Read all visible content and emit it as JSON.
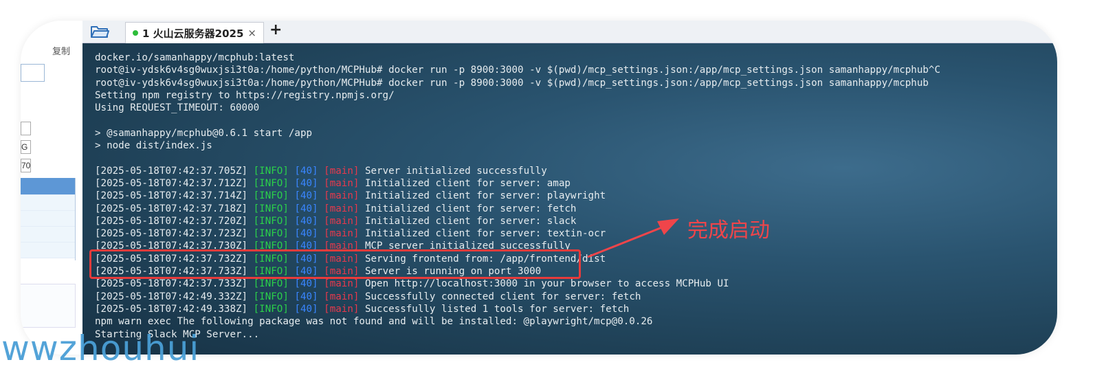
{
  "left_panel": {
    "copy_label": "复制",
    "box_c_text": "G",
    "box_d_text": "70"
  },
  "tab": {
    "title": "1 火山云服务器2025",
    "close_label": "×",
    "add_label": "+"
  },
  "terminal": {
    "header_lines": [
      "docker.io/samanhappy/mcphub:latest",
      "root@iv-ydsk6v4sg0wuxjsi3t0a:/home/python/MCPHub# docker run -p 8900:3000 -v $(pwd)/mcp_settings.json:/app/mcp_settings.json samanhappy/mcphub^C",
      "root@iv-ydsk6v4sg0wuxjsi3t0a:/home/python/MCPHub# docker run -p 8900:3000 -v $(pwd)/mcp_settings.json:/app/mcp_settings.json samanhappy/mcphub",
      "Setting npm registry to https://registry.npmjs.org/",
      "Using REQUEST_TIMEOUT: 60000",
      "",
      "> @samanhappy/mcphub@0.6.1 start /app",
      "> node dist/index.js",
      ""
    ],
    "log_lines": [
      {
        "ts": "[2025-05-18T07:42:37.705Z]",
        "level": "[INFO]",
        "pid": "[40]",
        "mod": "[main]",
        "msg": "Server initialized successfully"
      },
      {
        "ts": "[2025-05-18T07:42:37.712Z]",
        "level": "[INFO]",
        "pid": "[40]",
        "mod": "[main]",
        "msg": "Initialized client for server: amap"
      },
      {
        "ts": "[2025-05-18T07:42:37.714Z]",
        "level": "[INFO]",
        "pid": "[40]",
        "mod": "[main]",
        "msg": "Initialized client for server: playwright"
      },
      {
        "ts": "[2025-05-18T07:42:37.718Z]",
        "level": "[INFO]",
        "pid": "[40]",
        "mod": "[main]",
        "msg": "Initialized client for server: fetch"
      },
      {
        "ts": "[2025-05-18T07:42:37.720Z]",
        "level": "[INFO]",
        "pid": "[40]",
        "mod": "[main]",
        "msg": "Initialized client for server: slack"
      },
      {
        "ts": "[2025-05-18T07:42:37.723Z]",
        "level": "[INFO]",
        "pid": "[40]",
        "mod": "[main]",
        "msg": "Initialized client for server: textin-ocr"
      },
      {
        "ts": "[2025-05-18T07:42:37.730Z]",
        "level": "[INFO]",
        "pid": "[40]",
        "mod": "[main]",
        "msg": "MCP server initialized successfully"
      },
      {
        "ts": "[2025-05-18T07:42:37.732Z]",
        "level": "[INFO]",
        "pid": "[40]",
        "mod": "[main]",
        "msg": "Serving frontend from: /app/frontend/dist"
      },
      {
        "ts": "[2025-05-18T07:42:37.733Z]",
        "level": "[INFO]",
        "pid": "[40]",
        "mod": "[main]",
        "msg": "Server is running on port 3000"
      },
      {
        "ts": "[2025-05-18T07:42:37.733Z]",
        "level": "[INFO]",
        "pid": "[40]",
        "mod": "[main]",
        "msg": "Open http://localhost:3000 in your browser to access MCPHub UI"
      },
      {
        "ts": "[2025-05-18T07:42:49.332Z]",
        "level": "[INFO]",
        "pid": "[40]",
        "mod": "[main]",
        "msg": "Successfully connected client for server: fetch"
      },
      {
        "ts": "[2025-05-18T07:42:49.338Z]",
        "level": "[INFO]",
        "pid": "[40]",
        "mod": "[main]",
        "msg": "Successfully listed 1 tools for server: fetch"
      }
    ],
    "footer_lines": [
      "npm warn exec The following package was not found and will be installed: @playwright/mcp@0.0.26",
      "Starting Slack MCP Server..."
    ]
  },
  "annotation": {
    "text": "完成启动",
    "color": "#f0454a"
  },
  "watermark": {
    "text": "wwzhouhui"
  },
  "colors": {
    "info": "#2bd14a",
    "pid": "#3a86ff",
    "module": "#e8394c",
    "terminal_bg": "#1f4157",
    "highlight": "#e83b3b"
  }
}
